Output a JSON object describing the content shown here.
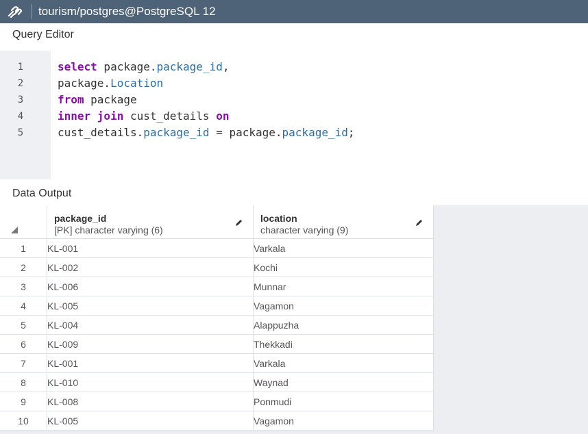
{
  "titlebar": {
    "connection_icon": "connection-icon",
    "title": "tourism/postgres@PostgreSQL 12"
  },
  "query_editor": {
    "label": "Query Editor",
    "line_numbers": [
      "1",
      "2",
      "3",
      "4",
      "5"
    ],
    "lines": [
      [
        {
          "t": "kw",
          "v": "select"
        },
        {
          "t": "pl",
          "v": " package."
        },
        {
          "t": "id",
          "v": "package_id"
        },
        {
          "t": "pl",
          "v": ","
        }
      ],
      [
        {
          "t": "pl",
          "v": "package."
        },
        {
          "t": "id",
          "v": "Location"
        }
      ],
      [
        {
          "t": "kw",
          "v": "from"
        },
        {
          "t": "pl",
          "v": " package"
        }
      ],
      [
        {
          "t": "kw",
          "v": "inner join"
        },
        {
          "t": "pl",
          "v": " cust_details "
        },
        {
          "t": "kw",
          "v": "on"
        }
      ],
      [
        {
          "t": "pl",
          "v": "cust_details."
        },
        {
          "t": "id",
          "v": "package_id"
        },
        {
          "t": "pl",
          "v": " = package."
        },
        {
          "t": "id",
          "v": "package_id"
        },
        {
          "t": "pl",
          "v": ";"
        }
      ]
    ]
  },
  "data_output": {
    "label": "Data Output",
    "columns": [
      {
        "name": "package_id",
        "type": "[PK] character varying (6)",
        "icon": "pencil-icon"
      },
      {
        "name": "location",
        "type": "character varying (9)",
        "icon": "pencil-icon"
      }
    ],
    "rows": [
      {
        "n": "1",
        "package_id": "KL-001",
        "location": "Varkala"
      },
      {
        "n": "2",
        "package_id": "KL-002",
        "location": "Kochi"
      },
      {
        "n": "3",
        "package_id": "KL-006",
        "location": "Munnar"
      },
      {
        "n": "4",
        "package_id": "KL-005",
        "location": "Vagamon"
      },
      {
        "n": "5",
        "package_id": "KL-004",
        "location": "Alappuzha"
      },
      {
        "n": "6",
        "package_id": "KL-009",
        "location": "Thekkadi"
      },
      {
        "n": "7",
        "package_id": "KL-001",
        "location": "Varkala"
      },
      {
        "n": "8",
        "package_id": "KL-010",
        "location": "Waynad"
      },
      {
        "n": "9",
        "package_id": "KL-008",
        "location": "Ponmudi"
      },
      {
        "n": "10",
        "package_id": "KL-005",
        "location": "Vagamon"
      }
    ]
  }
}
